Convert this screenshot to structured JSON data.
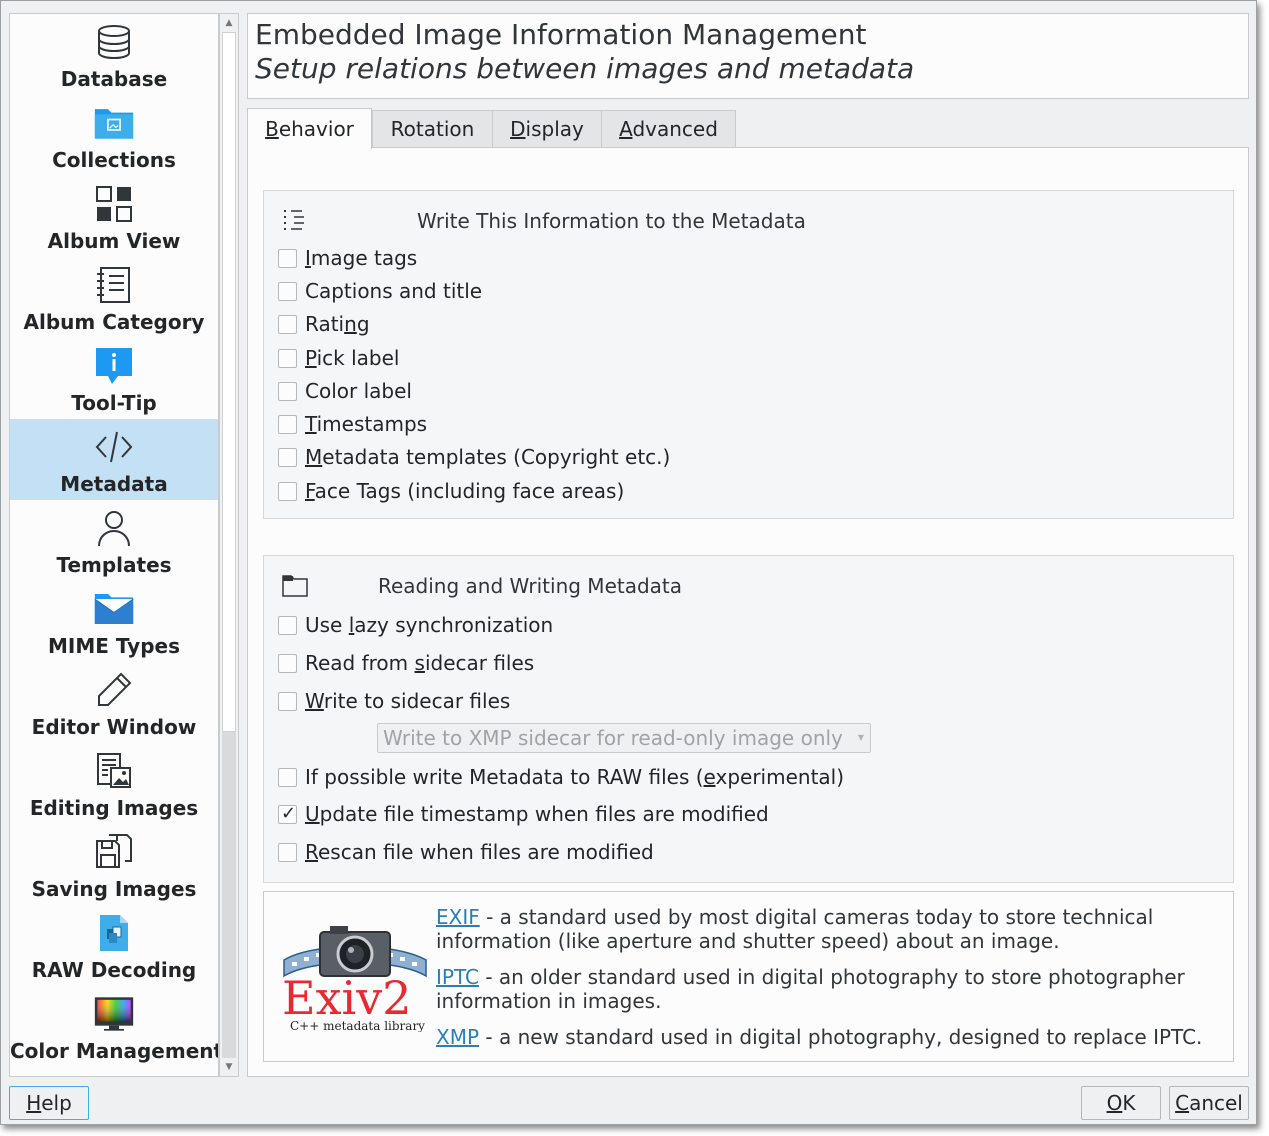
{
  "sidebar": {
    "items": [
      {
        "label": "Database",
        "icon": "database-icon"
      },
      {
        "label": "Collections",
        "icon": "collections-folder-icon"
      },
      {
        "label": "Album View",
        "icon": "album-view-icon"
      },
      {
        "label": "Album Category",
        "icon": "album-category-icon"
      },
      {
        "label": "Tool-Tip",
        "icon": "tooltip-icon"
      },
      {
        "label": "Metadata",
        "icon": "code-icon",
        "active": true
      },
      {
        "label": "Templates",
        "icon": "templates-user-icon"
      },
      {
        "label": "MIME Types",
        "icon": "mime-types-icon"
      },
      {
        "label": "Editor Window",
        "icon": "pencil-icon"
      },
      {
        "label": "Editing Images",
        "icon": "editing-images-icon"
      },
      {
        "label": "Saving Images",
        "icon": "saving-images-icon"
      },
      {
        "label": "RAW Decoding",
        "icon": "raw-decoding-icon"
      },
      {
        "label": "Color Management",
        "icon": "color-management-icon"
      }
    ]
  },
  "header": {
    "title": "Embedded Image Information Management",
    "subtitle": "Setup relations between images and metadata"
  },
  "tabs": [
    {
      "label": "Behavior",
      "active": true
    },
    {
      "label": "Rotation"
    },
    {
      "label": "Display"
    },
    {
      "label": "Advanced"
    }
  ],
  "write_group": {
    "title": "Write This Information to the Metadata",
    "options": [
      {
        "label": "Image tags",
        "checked": false
      },
      {
        "label": "Captions and title",
        "checked": false
      },
      {
        "label": "Rating",
        "checked": false
      },
      {
        "label": "Pick label",
        "checked": false
      },
      {
        "label": "Color label",
        "checked": false
      },
      {
        "label": "Timestamps",
        "checked": false
      },
      {
        "label": "Metadata templates (Copyright etc.)",
        "checked": false
      },
      {
        "label": "Face Tags (including face areas)",
        "checked": false
      }
    ]
  },
  "rw_group": {
    "title": "Reading and Writing Metadata",
    "options": [
      {
        "label": "Use lazy synchronization",
        "checked": false
      },
      {
        "label": "Read from sidecar files",
        "checked": false
      },
      {
        "label": "Write to sidecar files",
        "checked": false
      },
      {
        "label": "If possible write Metadata to RAW files (experimental)",
        "checked": false
      },
      {
        "label": "Update file timestamp when files are modified",
        "checked": true
      },
      {
        "label": "Rescan file when files are modified",
        "checked": false
      }
    ],
    "sidecar_mode": "Write to XMP sidecar for read-only image only"
  },
  "info": {
    "logo_text": "Exiv2",
    "logo_caption": "C++ metadata library",
    "exif_link": "EXIF",
    "exif_line1": " - a standard used by most digital cameras today to store technical",
    "exif_line2": "information (like aperture and shutter speed) about an image.",
    "iptc_link": "IPTC",
    "iptc_line1": " - an older standard used in digital photography to store photographer",
    "iptc_line2": "information in images.",
    "xmp_link": "XMP",
    "xmp_line1": " - a new standard used in digital photography, designed to replace IPTC."
  },
  "buttons": {
    "help": "Help",
    "ok": "OK",
    "cancel": "Cancel"
  }
}
